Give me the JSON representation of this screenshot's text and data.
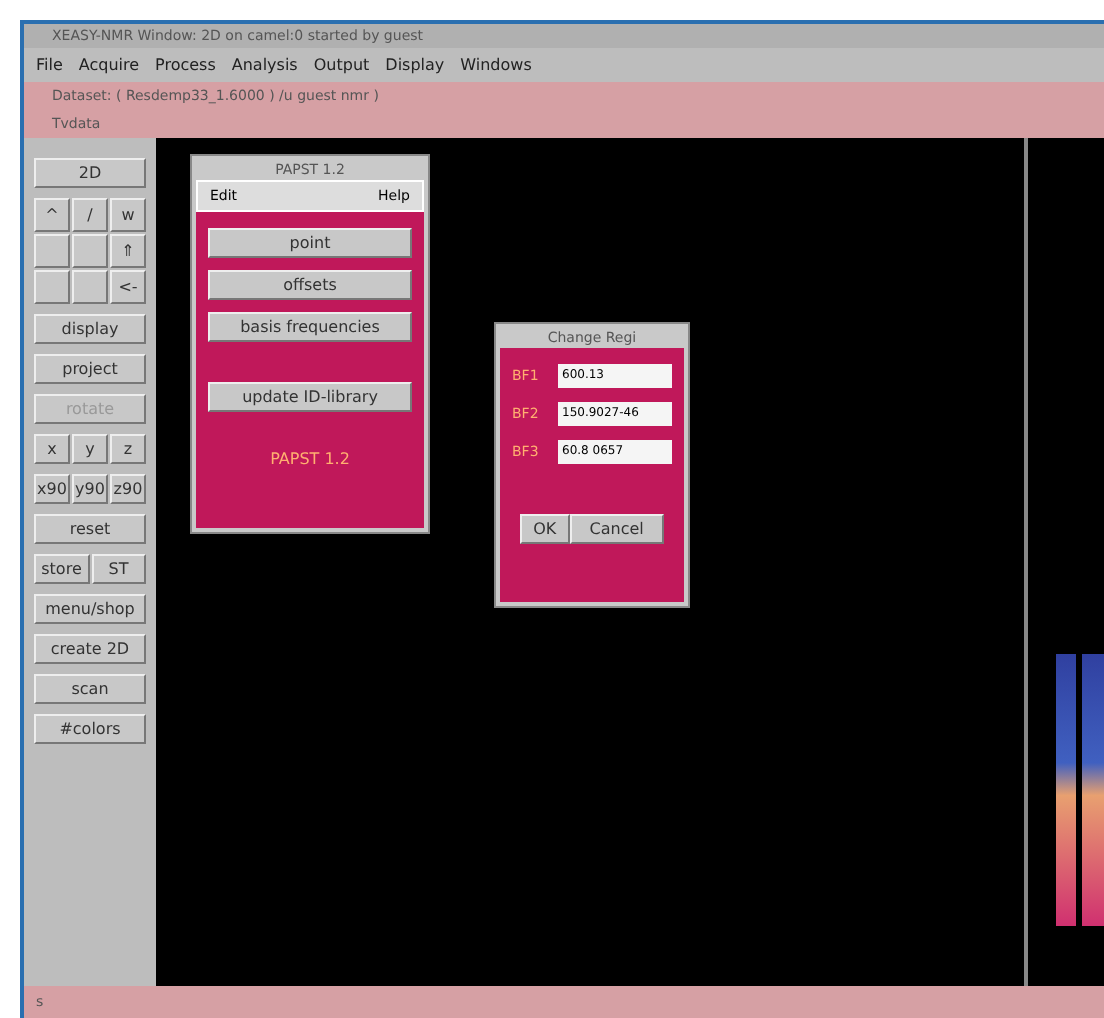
{
  "window": {
    "title": "XEASY-NMR Window: 2D on camel:0 started by guest"
  },
  "menu": [
    "File",
    "Acquire",
    "Process",
    "Analysis",
    "Output",
    "Display",
    "Windows"
  ],
  "info_lines": [
    "Dataset: ( Resdemp33_1.6000 ) /u guest nmr )",
    "Tvdata"
  ],
  "sidebar": [
    {
      "kind": "button",
      "label": "2D",
      "disabled": false
    },
    {
      "kind": "grid",
      "cells": [
        "^",
        "/",
        "w",
        "",
        "",
        "⇑",
        "",
        "",
        "<-"
      ]
    },
    {
      "kind": "button",
      "label": "display",
      "disabled": false
    },
    {
      "kind": "button",
      "label": "project",
      "disabled": false
    },
    {
      "kind": "button",
      "label": "rotate",
      "disabled": true
    },
    {
      "kind": "row",
      "cells": [
        "x",
        "y",
        "z"
      ]
    },
    {
      "kind": "row",
      "cells": [
        "x90",
        "y90",
        "z90"
      ]
    },
    {
      "kind": "button",
      "label": "reset",
      "disabled": false
    },
    {
      "kind": "row",
      "cells": [
        "store",
        "ST"
      ]
    },
    {
      "kind": "button",
      "label": "menu/shop",
      "disabled": false
    },
    {
      "kind": "button",
      "label": "create 2D",
      "disabled": false
    },
    {
      "kind": "button",
      "label": "scan",
      "disabled": false
    },
    {
      "kind": "button",
      "label": "#colors",
      "disabled": false
    }
  ],
  "papst_dialog": {
    "title": "PAPST 1.2",
    "menu": [
      "Edit",
      "Help"
    ],
    "buttons": [
      "point",
      "offsets",
      "basis frequencies",
      "update ID-library"
    ],
    "footer": "PAPST 1.2"
  },
  "change_dialog": {
    "title": "Change Regi",
    "fields": [
      {
        "label": "BF1",
        "value": "600.13"
      },
      {
        "label": "BF2",
        "value": "150.9027-46"
      },
      {
        "label": "BF3",
        "value": "60.8 0657"
      }
    ],
    "buttons": [
      "OK",
      "Cancel"
    ]
  },
  "status_bar": "s"
}
